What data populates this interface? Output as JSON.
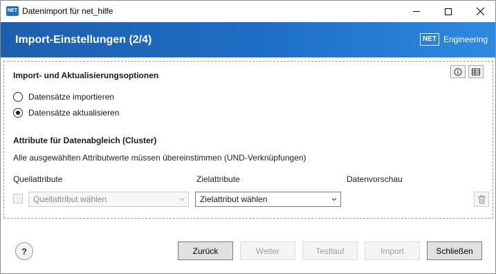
{
  "window": {
    "app_icon_text": "NET",
    "title": "Datenimport für net_hilfe"
  },
  "header": {
    "title": "Import-Einstellungen (2/4)",
    "brand_box": "NET",
    "brand_text": "Engineering"
  },
  "options": {
    "section_title": "Import- und Aktualisierungsoptionen",
    "radios": [
      {
        "label": "Datensätze importieren",
        "checked": false
      },
      {
        "label": "Datensätze aktualisieren",
        "checked": true
      }
    ]
  },
  "cluster": {
    "section_title": "Attribute für Datenabgleich (Cluster)",
    "description": "Alle ausgewählten Attributwerte müssen übereinstimmen (UND-Verknüpfungen)",
    "columns": {
      "source": "Quellattribute",
      "target": "Zielattribute",
      "preview": "Datenvorschau"
    },
    "row": {
      "source_placeholder": "Quellattribut wählen",
      "target_placeholder": "Zielattribut wählen"
    }
  },
  "footer": {
    "help": "?",
    "buttons": {
      "back": "Zurück",
      "next": "Weiter",
      "testrun": "Testlauf",
      "import": "Import",
      "close": "Schließen"
    }
  },
  "colors": {
    "header_start": "#1d5fae",
    "header_end": "#2d8ae0"
  }
}
